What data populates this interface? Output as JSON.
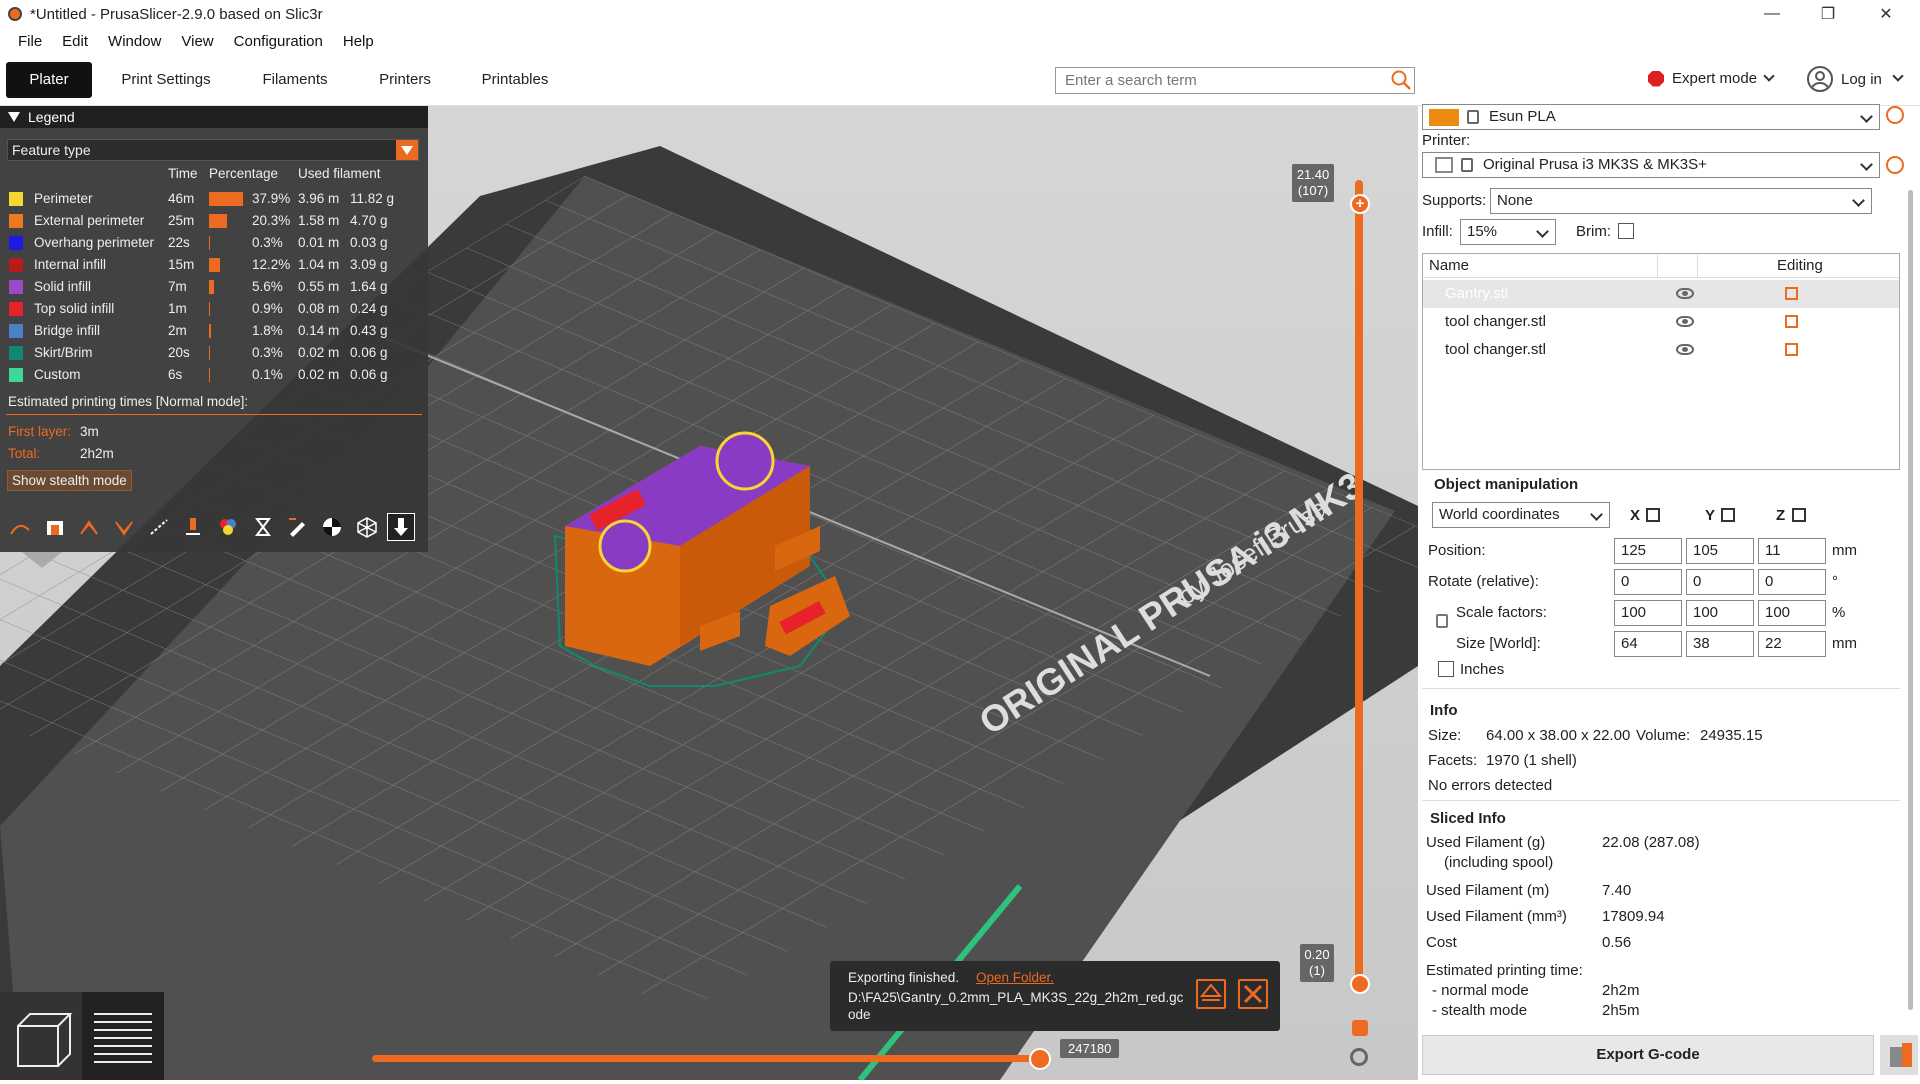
{
  "window": {
    "title": "*Untitled - PrusaSlicer-2.9.0 based on Slic3r",
    "controls": [
      "—",
      "❐",
      "✕"
    ]
  },
  "menu": [
    "File",
    "Edit",
    "Window",
    "View",
    "Configuration",
    "Help"
  ],
  "tabs": [
    "Plater",
    "Print Settings",
    "Filaments",
    "Printers",
    "Printables"
  ],
  "search": {
    "placeholder": "Enter a search term"
  },
  "mode": {
    "label": "Expert mode"
  },
  "login": {
    "label": "Log in"
  },
  "legend": {
    "title": "Legend",
    "view_type": "Feature type",
    "headers": {
      "time": "Time",
      "percentage": "Percentage",
      "used": "Used filament"
    },
    "rows": [
      {
        "name": "Perimeter",
        "color": "#f7d631",
        "time": "46m",
        "pct": "37.9%",
        "pct_value": 37.9,
        "m": "3.96 m",
        "g": "11.82 g"
      },
      {
        "name": "External perimeter",
        "color": "#ed7a1d",
        "time": "25m",
        "pct": "20.3%",
        "pct_value": 20.3,
        "m": "1.58 m",
        "g": "4.70 g"
      },
      {
        "name": "Overhang perimeter",
        "color": "#1c1ce0",
        "time": "22s",
        "pct": "0.3%",
        "pct_value": 0.3,
        "m": "0.01 m",
        "g": "0.03 g"
      },
      {
        "name": "Internal infill",
        "color": "#b51c1c",
        "time": "15m",
        "pct": "12.2%",
        "pct_value": 12.2,
        "m": "1.04 m",
        "g": "3.09 g"
      },
      {
        "name": "Solid infill",
        "color": "#9a49c9",
        "time": "7m",
        "pct": "5.6%",
        "pct_value": 5.6,
        "m": "0.55 m",
        "g": "1.64 g"
      },
      {
        "name": "Top solid infill",
        "color": "#e8222a",
        "time": "1m",
        "pct": "0.9%",
        "pct_value": 0.9,
        "m": "0.08 m",
        "g": "0.24 g"
      },
      {
        "name": "Bridge infill",
        "color": "#4d7fc6",
        "time": "2m",
        "pct": "1.8%",
        "pct_value": 1.8,
        "m": "0.14 m",
        "g": "0.43 g"
      },
      {
        "name": "Skirt/Brim",
        "color": "#0f8a70",
        "time": "20s",
        "pct": "0.3%",
        "pct_value": 0.3,
        "m": "0.02 m",
        "g": "0.06 g"
      },
      {
        "name": "Custom",
        "color": "#3fd69d",
        "time": "6s",
        "pct": "0.1%",
        "pct_value": 0.1,
        "m": "0.02 m",
        "g": "0.06 g"
      }
    ],
    "estimated": "Estimated printing times [Normal mode]:",
    "first_layer_label": "First layer:",
    "first_layer": "3m",
    "total_label": "Total:",
    "total": "2h2m",
    "stealth_btn": "Show stealth mode"
  },
  "bed": {
    "line1": "ORIGINAL PRUSA i3 MK3",
    "line2": "by Josef Prusa"
  },
  "vslider": {
    "top": "21.40\n(107)",
    "bottom": "0.20\n(1)"
  },
  "hslider": {
    "value": "247180"
  },
  "toast": {
    "text": "Exporting finished.",
    "link": "Open Folder.",
    "path": "D:\\FA25\\Gantry_0.2mm_PLA_MK3S_22g_2h2m_red.gcode"
  },
  "right": {
    "filament": "Esun PLA",
    "printer_label": "Printer:",
    "printer": "Original Prusa i3 MK3S & MK3S+",
    "supports_label": "Supports:",
    "supports": "None",
    "infill_label": "Infill:",
    "infill": "15%",
    "brim_label": "Brim:",
    "list_headers": {
      "name": "Name",
      "editing": "Editing"
    },
    "objects": [
      "Gantry.stl",
      "tool changer.stl",
      "tool changer.stl"
    ],
    "objmanip": {
      "title": "Object manipulation",
      "coords": "World coordinates",
      "axes": [
        "X",
        "Y",
        "Z"
      ],
      "rows": [
        {
          "label": "Position:",
          "vals": [
            "125",
            "105",
            "11"
          ],
          "unit": "mm"
        },
        {
          "label": "Rotate (relative):",
          "vals": [
            "0",
            "0",
            "0"
          ],
          "unit": "°"
        },
        {
          "label": "Scale factors:",
          "vals": [
            "100",
            "100",
            "100"
          ],
          "unit": "%"
        },
        {
          "label": "Size [World]:",
          "vals": [
            "64",
            "38",
            "22"
          ],
          "unit": "mm"
        }
      ],
      "inches": "Inches"
    },
    "info": {
      "title": "Info",
      "size_label": "Size:",
      "size": "64.00 x 38.00 x 22.00",
      "volume_label": "Volume:",
      "volume": "24935.15",
      "facets_label": "Facets:",
      "facets": "1970 (1 shell)",
      "errors": "No errors detected"
    },
    "sliced": {
      "title": "Sliced Info",
      "rows": [
        {
          "label": "Used Filament (g)",
          "value": "22.08 (287.08)"
        },
        {
          "label": "(including spool)",
          "value": ""
        },
        {
          "label": "Used Filament (m)",
          "value": "7.40"
        },
        {
          "label": "Used Filament (mm³)",
          "value": "17809.94"
        },
        {
          "label": "Cost",
          "value": "0.56"
        },
        {
          "label": "Estimated printing time:",
          "value": ""
        },
        {
          "label": "- normal mode",
          "value": "2h2m"
        },
        {
          "label": "- stealth mode",
          "value": "2h5m"
        }
      ]
    },
    "export": "Export G-code"
  }
}
